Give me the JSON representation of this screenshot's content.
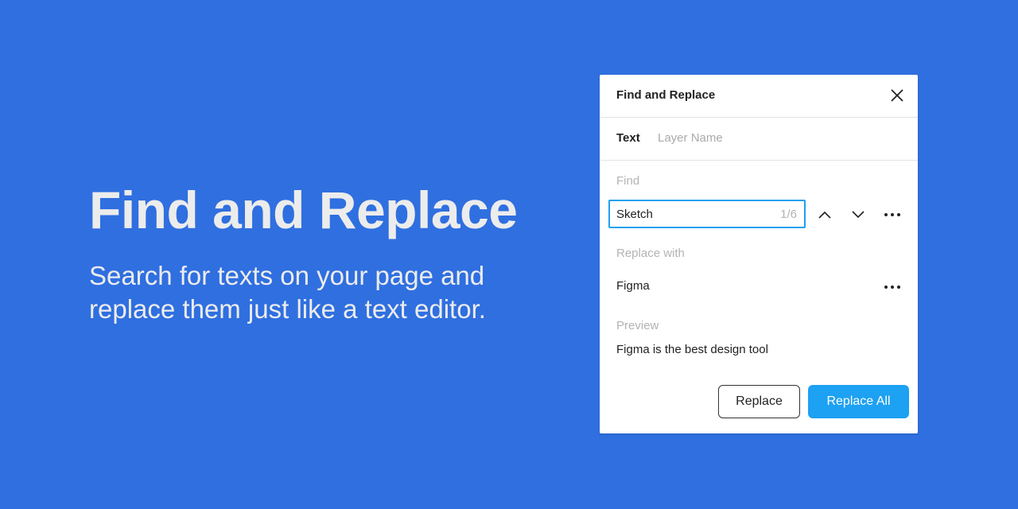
{
  "hero": {
    "title": "Find and Replace",
    "subtitle": "Search for texts on your page and replace them just like a text editor."
  },
  "dialog": {
    "title": "Find and Replace",
    "close_icon": "close-icon",
    "tabs": [
      {
        "label": "Text",
        "active": true
      },
      {
        "label": "Layer Name",
        "active": false
      }
    ],
    "find": {
      "label": "Find",
      "value": "Sketch",
      "match_count": "1/6",
      "prev_icon": "chevron-up-icon",
      "next_icon": "chevron-down-icon",
      "more_icon": "more-horizontal-icon"
    },
    "replace": {
      "label": "Replace with",
      "value": "Figma",
      "more_icon": "more-horizontal-icon"
    },
    "preview": {
      "label": "Preview",
      "text": "Figma is the best design tool"
    },
    "buttons": {
      "replace": "Replace",
      "replace_all": "Replace All"
    }
  },
  "colors": {
    "background": "#2f6fe0",
    "accent": "#1da1f2",
    "hero_text": "#ececec"
  }
}
